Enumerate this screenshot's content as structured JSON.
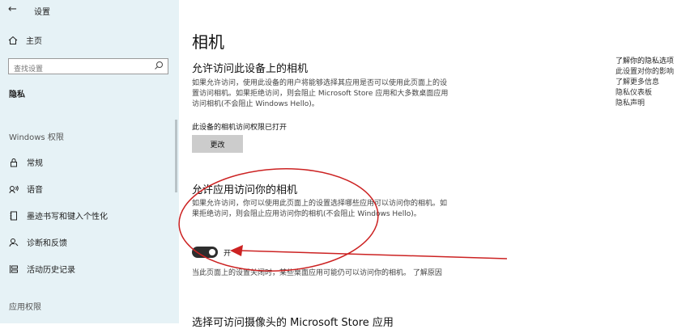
{
  "window": {
    "title": "设置"
  },
  "sidebar": {
    "home_label": "主页",
    "search_placeholder": "查找设置",
    "category": "隐私",
    "windows_section": "Windows 权限",
    "items": [
      {
        "label": "常规",
        "icon": "lock-icon"
      },
      {
        "label": "语音",
        "icon": "speech-icon"
      },
      {
        "label": "墨迹书写和键入个性化",
        "icon": "notebook-icon"
      },
      {
        "label": "诊断和反馈",
        "icon": "feedback-icon"
      },
      {
        "label": "活动历史记录",
        "icon": "timeline-icon"
      }
    ],
    "app_section": "应用权限"
  },
  "main": {
    "title": "相机",
    "device_section": {
      "title": "允许访问此设备上的相机",
      "desc": "如果允许访问，使用此设备的用户将能够选择其应用是否可以使用此页面上的设置访问相机。如果拒绝访问，则会阻止 Microsoft Store 应用和大多数桌面应用访问相机(不会阻止 Windows Hello)。",
      "status": "此设备的相机访问权限已打开",
      "change_button": "更改"
    },
    "app_section": {
      "title": "允许应用访问你的相机",
      "desc": "如果允许访问，你可以使用此页面上的设置选择哪些应用可以访问你的相机。如果拒绝访问，则会阻止应用访问你的相机(不会阻止 Windows Hello)。",
      "toggle_label": "开",
      "toggle_on": true,
      "note": "当此页面上的设置关闭时，某些桌面应用可能仍可以访问你的相机。",
      "note_link": "了解原因"
    },
    "store_section_title": "选择可访问摄像头的 Microsoft Store 应用"
  },
  "related": {
    "title": "了解你的隐私选项",
    "links": [
      "此设置对你的影响",
      "了解更多信息",
      "隐私仪表板",
      "隐私声明"
    ]
  },
  "colors": {
    "sidebar_bg": "#e6f2f6",
    "annotation": "#cc2222",
    "toggle_on": "#2d2d2d"
  }
}
